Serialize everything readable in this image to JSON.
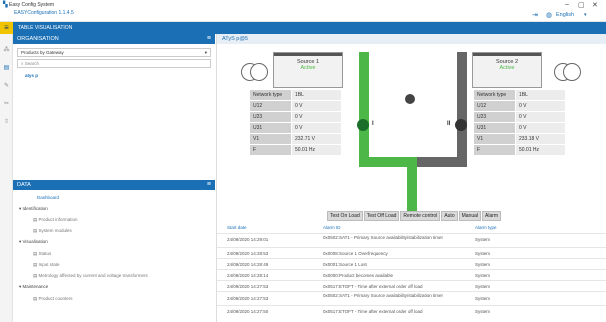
{
  "window": {
    "title": "Easy Config System",
    "app_name": "EASYConfiguration 1.1.4.5",
    "language": "English"
  },
  "navbar": {
    "label": "TABLE VISUALISATION"
  },
  "organisation": {
    "title": "ORGANISATION",
    "filter": "Products by Gateway",
    "search_placeholder": "Search",
    "node": "atys p"
  },
  "data_panel": {
    "title": "DATA",
    "dashboard": "Dashboard",
    "identification": "Identification",
    "product_information": "Product information",
    "system_modules": "System modules",
    "visualisation": "Visualisation",
    "status": "Status",
    "input_state": "Input state",
    "metrology": "Metrology affected by current and voltage transformers",
    "maintenance": "Maintenance",
    "product_counters": "Product counters"
  },
  "main": {
    "title": "ATyS p@5",
    "source1": {
      "name": "Source 1",
      "state": "Active"
    },
    "source2": {
      "name": "Source 2",
      "state": "Active"
    },
    "labels": [
      "Network type",
      "U12",
      "U23",
      "U31",
      "V1",
      "F"
    ],
    "source1_values": [
      "1BL",
      "0 V",
      "0 V",
      "0 V",
      "232.71 V",
      "50.01 Hz"
    ],
    "source2_values": [
      "1BL",
      "0 V",
      "0 V",
      "0 V",
      "233.18 V",
      "50.01 Hz"
    ],
    "switch_left": "I",
    "switch_right": "II",
    "buttons": [
      "Test On Load",
      "Test Off Load",
      "Remote control",
      "Auto",
      "Manual",
      "Alarm"
    ],
    "alarm_headers": [
      "Start date",
      "Alarm ID",
      "Alarm type"
    ],
    "alarms": [
      {
        "date": "24/09/2020 14:29:01",
        "id": "0x0502:SAT1 - Primary Source availability/stabilization timer",
        "type": "System"
      },
      {
        "date": "24/09/2020 14:28:53",
        "id": "0x0008:Source 1 Overfrequency",
        "type": "System"
      },
      {
        "date": "24/09/2020 14:28:49",
        "id": "0x0001:Source 1 Lost",
        "type": "System"
      },
      {
        "date": "24/09/2020 14:28:14",
        "id": "0x0000:Product becomes available",
        "type": "System"
      },
      {
        "date": "24/09/2020 14:27:53",
        "id": "0x0517:ETOFT - Time after external order off load",
        "type": "System"
      },
      {
        "date": "24/09/2020 14:27:53",
        "id": "0x0502:SAT1 - Primary Source availability/stabilization timer",
        "type": "System"
      },
      {
        "date": "24/09/2020 14:27:50",
        "id": "0x0517:ETOFT - Time after external order off load",
        "type": "System"
      }
    ]
  },
  "colors": {
    "brand": "#1a6fb5",
    "active": "#4db848",
    "menu": "#f0c400"
  }
}
